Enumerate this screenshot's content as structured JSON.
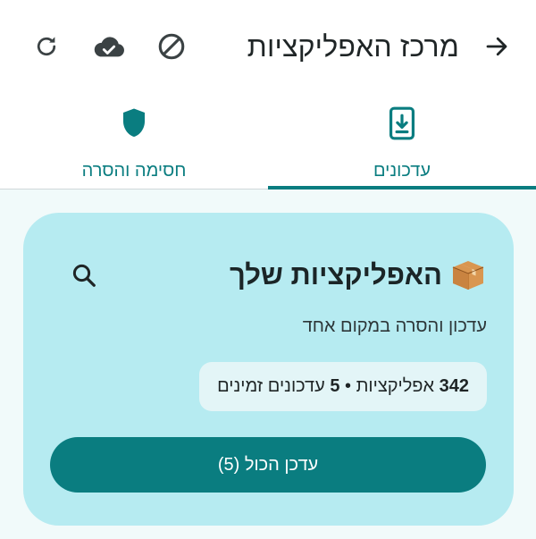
{
  "header": {
    "title": "מרכז האפליקציות",
    "back_icon": "arrow-back-icon",
    "actions": [
      "refresh-icon",
      "cloud-done-icon",
      "block-icon"
    ]
  },
  "tabs": [
    {
      "label": "עדכונים",
      "icon": "phone-download-icon",
      "active": true
    },
    {
      "label": "חסימה והסרה",
      "icon": "shield-icon",
      "active": false
    }
  ],
  "card": {
    "title": "האפליקציות שלך",
    "subtitle": "עדכון והסרה במקום אחד",
    "stats": {
      "apps_count": "342",
      "apps_label": "אפליקציות",
      "separator": "•",
      "updates_count": "5",
      "updates_label": "עדכונים זמינים"
    },
    "update_all_label": "עדכן הכול (5)"
  },
  "colors": {
    "accent": "#0a7d80",
    "card_bg": "#b6ebf1",
    "chip_bg": "#e3f5f7",
    "page_bg": "#f1fafa"
  }
}
